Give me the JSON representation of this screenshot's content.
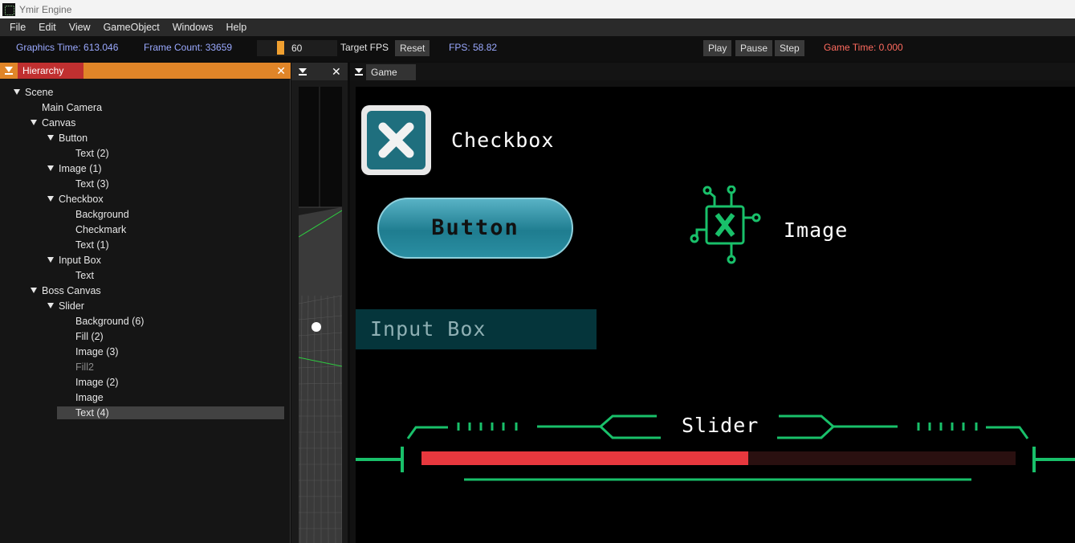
{
  "window": {
    "title": "Ymir Engine"
  },
  "menu": [
    "File",
    "Edit",
    "View",
    "GameObject",
    "Windows",
    "Help"
  ],
  "toolbar": {
    "graphics_time": "Graphics Time: 613.046",
    "frame_count": "Frame Count: 33659",
    "fps_value": "60",
    "target_fps_label": "Target FPS",
    "reset_label": "Reset",
    "fps": "FPS: 58.82",
    "play_label": "Play",
    "pause_label": "Pause",
    "step_label": "Step",
    "game_time": "Game Time: 0.000"
  },
  "hierarchy": {
    "title": "Hierarchy",
    "close": "✕",
    "nodes": [
      {
        "label": "Scene",
        "depth": 0,
        "expanded": true
      },
      {
        "label": "Main Camera",
        "depth": 1,
        "expanded": false
      },
      {
        "label": "Canvas",
        "depth": 1,
        "expanded": true
      },
      {
        "label": "Button",
        "depth": 2,
        "expanded": true
      },
      {
        "label": "Text (2)",
        "depth": 3,
        "expanded": false
      },
      {
        "label": "Image (1)",
        "depth": 2,
        "expanded": true
      },
      {
        "label": "Text (3)",
        "depth": 3,
        "expanded": false
      },
      {
        "label": "Checkbox",
        "depth": 2,
        "expanded": true
      },
      {
        "label": "Background",
        "depth": 3,
        "expanded": false
      },
      {
        "label": "Checkmark",
        "depth": 3,
        "expanded": false
      },
      {
        "label": "Text (1)",
        "depth": 3,
        "expanded": false
      },
      {
        "label": "Input Box",
        "depth": 2,
        "expanded": true
      },
      {
        "label": "Text",
        "depth": 3,
        "expanded": false
      },
      {
        "label": "Boss Canvas",
        "depth": 1,
        "expanded": true
      },
      {
        "label": "Slider",
        "depth": 2,
        "expanded": true
      },
      {
        "label": "Background (6)",
        "depth": 3,
        "expanded": false
      },
      {
        "label": "Fill (2)",
        "depth": 3,
        "expanded": false
      },
      {
        "label": "Image (3)",
        "depth": 3,
        "expanded": false
      },
      {
        "label": "Fill2",
        "depth": 3,
        "expanded": false,
        "disabled": true
      },
      {
        "label": "Image (2)",
        "depth": 3,
        "expanded": false
      },
      {
        "label": "Image",
        "depth": 3,
        "expanded": false
      },
      {
        "label": "Text (4)",
        "depth": 3,
        "expanded": false,
        "selected": true
      }
    ]
  },
  "scene_panel": {
    "close": "✕"
  },
  "game_panel": {
    "tab": "Game",
    "checkbox_label": "Checkbox",
    "button_label": "Button",
    "image_label": "Image",
    "input_placeholder": "Input Box",
    "slider_label": "Slider",
    "slider_fill_fraction": 0.55
  },
  "colors": {
    "accent_orange": "#e08528",
    "tab_red": "#c03030",
    "info_blue": "#9aa9ff",
    "game_time_red": "#ff6b5f",
    "hud_green": "#19c06a",
    "slider_red": "#e8383e"
  }
}
